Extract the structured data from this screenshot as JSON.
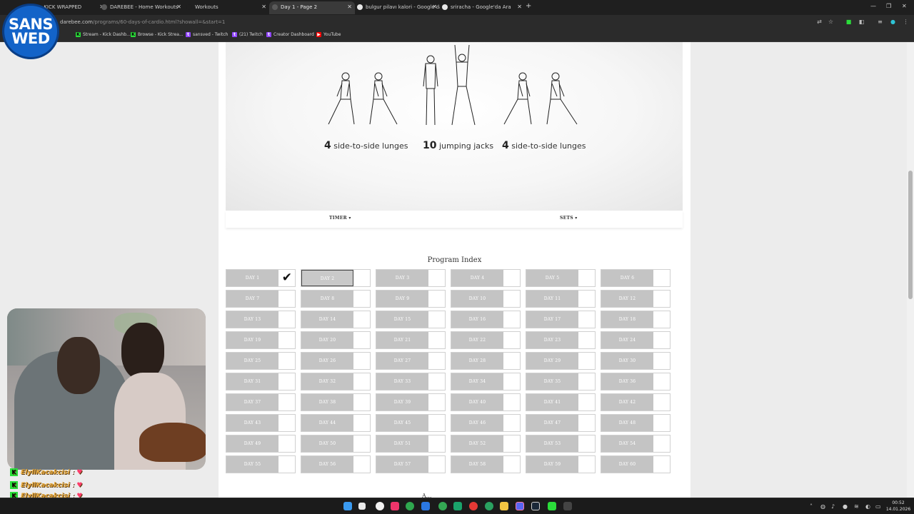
{
  "browser": {
    "tabs": [
      {
        "title": "EL - KICK WRAPPED",
        "active": false
      },
      {
        "title": "DAREBEE - Home Workouts",
        "active": false
      },
      {
        "title": "Workouts",
        "active": false
      },
      {
        "title": "Day 1 - Page 2",
        "active": true
      },
      {
        "title": "bulgur pilavı kalori - Google'da",
        "active": false
      },
      {
        "title": "sriracha - Google'da Ara",
        "active": false
      }
    ],
    "new_tab_glyph": "+",
    "url_host": "darebee.com",
    "url_path": "/programs/60-days-of-cardio.html?showall=&start=1",
    "bookmarks": [
      {
        "label": "Stream - Kick Dashb...",
        "icon": "kick-icon",
        "color": "#2bdc3a"
      },
      {
        "label": "Browse - Kick Strea...",
        "icon": "kick-icon",
        "color": "#2bdc3a"
      },
      {
        "label": "sansved - Twitch",
        "icon": "twitch-icon",
        "color": "#9146ff"
      },
      {
        "label": "(21) Twitch",
        "icon": "twitch-icon",
        "color": "#9146ff"
      },
      {
        "label": "Creator Dashboard",
        "icon": "twitch-icon",
        "color": "#9146ff"
      },
      {
        "label": "YouTube",
        "icon": "youtube-icon",
        "color": "#ff0000"
      }
    ]
  },
  "stream_logo": {
    "line1": "SANS",
    "line2": "WED"
  },
  "workout": {
    "exercises": [
      {
        "count": "4",
        "name": "side-to-side lunges"
      },
      {
        "count": "10",
        "name": "jumping jacks"
      },
      {
        "count": "4",
        "name": "side-to-side lunges"
      }
    ],
    "timer_label": "TIMER ▾",
    "sets_label": "SETS ▾"
  },
  "program": {
    "title": "Program Index",
    "completed_days": [
      1
    ],
    "current_day": 2,
    "days": [
      "DAY 1",
      "DAY 2",
      "DAY 3",
      "DAY 4",
      "DAY 5",
      "DAY 6",
      "DAY 7",
      "DAY 8",
      "DAY 9",
      "DAY 10",
      "DAY 11",
      "DAY 12",
      "DAY 13",
      "DAY 14",
      "DAY 15",
      "DAY 16",
      "DAY 17",
      "DAY 18",
      "DAY 19",
      "DAY 20",
      "DAY 21",
      "DAY 22",
      "DAY 23",
      "DAY 24",
      "DAY 25",
      "DAY 26",
      "DAY 27",
      "DAY 28",
      "DAY 29",
      "DAY 30",
      "DAY 31",
      "DAY 32",
      "DAY 33",
      "DAY 34",
      "DAY 35",
      "DAY 36",
      "DAY 37",
      "DAY 38",
      "DAY 39",
      "DAY 40",
      "DAY 41",
      "DAY 42",
      "DAY 43",
      "DAY 44",
      "DAY 45",
      "DAY 46",
      "DAY 47",
      "DAY 48",
      "DAY 49",
      "DAY 50",
      "DAY 51",
      "DAY 52",
      "DAY 53",
      "DAY 54",
      "DAY 55",
      "DAY 56",
      "DAY 57",
      "DAY 58",
      "DAY 59",
      "DAY 60"
    ],
    "next_heading": "A..."
  },
  "chat": [
    {
      "user": "ElyllKacakcisi",
      "emote": "♥"
    },
    {
      "user": "ElyllKacakcisi",
      "emote": "♥"
    },
    {
      "user": "ElyllKacakcisi",
      "emote": "♥"
    }
  ],
  "taskbar": {
    "time": "00:52",
    "date": "14.01.2026"
  }
}
